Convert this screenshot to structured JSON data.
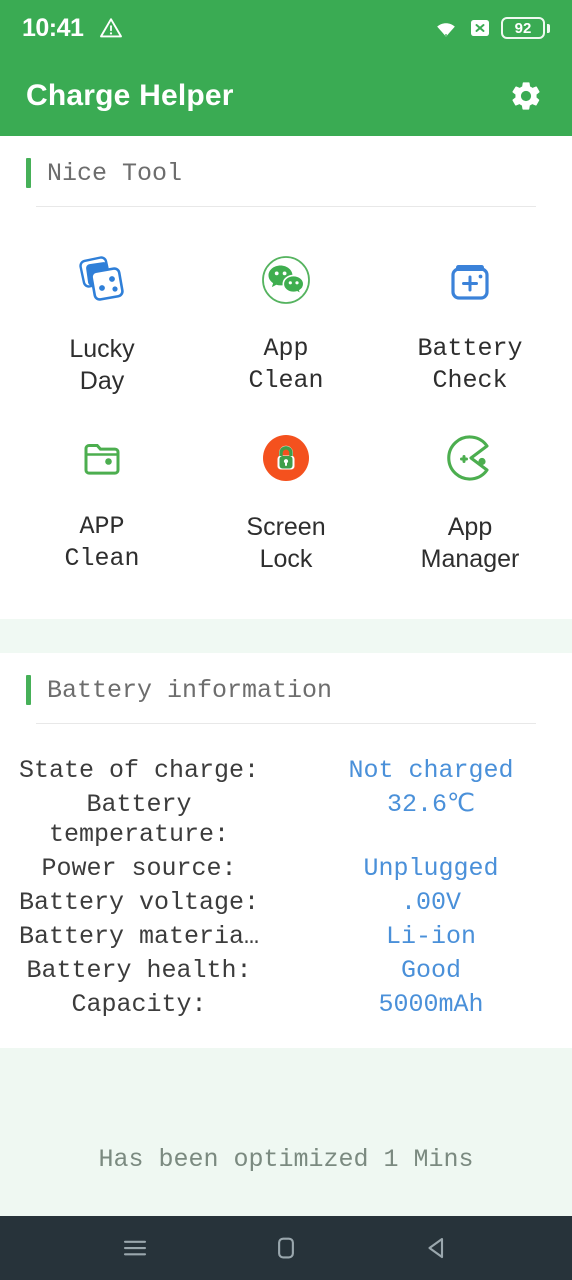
{
  "status_bar": {
    "time": "10:41",
    "warning_icon": "warning-triangle-icon",
    "wifi_icon": "wifi-icon",
    "x_icon": "x-box-icon",
    "battery_level": "92"
  },
  "app_bar": {
    "title": "Charge Helper",
    "settings_icon": "gear-icon"
  },
  "tools_section": {
    "title": "Nice Tool",
    "items": [
      {
        "label": "Lucky\nDay",
        "label_line1": "Lucky",
        "label_line2": "Day",
        "icon": "dice-icon",
        "font": "sans"
      },
      {
        "label": "App\nClean",
        "label_line1": "App",
        "label_line2": "Clean",
        "icon": "wechat-bubbles-icon",
        "font": "mono"
      },
      {
        "label": "Battery\nCheck",
        "label_line1": "Battery",
        "label_line2": "Check",
        "icon": "battery-plus-icon",
        "font": "mono"
      },
      {
        "label": "APP\nClean",
        "label_line1": "APP",
        "label_line2": "Clean",
        "icon": "folder-icon",
        "font": "mono"
      },
      {
        "label": "Screen\nLock",
        "label_line1": "Screen",
        "label_line2": "Lock",
        "icon": "lock-circle-icon",
        "font": "sans"
      },
      {
        "label": "App\nManager",
        "label_line1": "App",
        "label_line2": "Manager",
        "icon": "pacman-plus-icon",
        "font": "sans"
      }
    ]
  },
  "battery_section": {
    "title": "Battery information",
    "rows": [
      {
        "key": "State of charge:",
        "value": "Not charged"
      },
      {
        "key": "Battery temperature:",
        "key_line1": "Battery",
        "key_line2": "temperature:",
        "value": "32.6℃"
      },
      {
        "key": "Power source:",
        "value": "Unplugged"
      },
      {
        "key": "Battery voltage:",
        "value": ".00V"
      },
      {
        "key": "Battery materia…",
        "value": "Li-ion"
      },
      {
        "key": "Battery health:",
        "value": "Good"
      },
      {
        "key": "Capacity:",
        "value": "5000mAh"
      }
    ]
  },
  "footer": {
    "optimized_text": "Has been optimized 1 Mins"
  },
  "nav_bar": {
    "recents_icon": "menu-icon",
    "home_icon": "home-square-icon",
    "back_icon": "back-triangle-icon"
  },
  "colors": {
    "brand_green": "#3aab53",
    "accent_green": "#46b058",
    "value_blue": "#4a90d9",
    "tint_green": "#eff8f2",
    "nav_dark": "#27333a",
    "orange": "#f4511e"
  }
}
